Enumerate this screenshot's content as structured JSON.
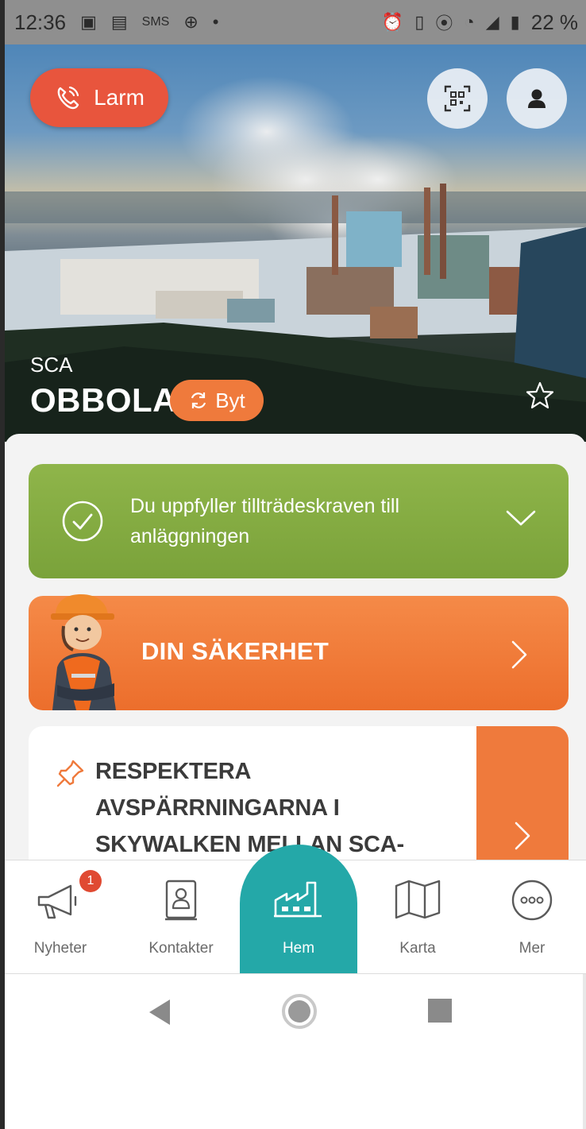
{
  "status_bar": {
    "time": "12:36",
    "battery": "22 %",
    "icons": [
      "image-icon",
      "gallery-icon",
      "sms-icon",
      "app-icon",
      "dot-icon",
      "alarm-icon",
      "vibrate-icon",
      "location-icon",
      "wifi-icon",
      "signal-icon",
      "battery-icon"
    ]
  },
  "hero": {
    "alarm_button": "Larm",
    "site_company": "SCA",
    "site_name": "OBBOLA",
    "switch_button": "Byt"
  },
  "access_card": {
    "text": "Du uppfyller tillträdeskraven till anläggningen"
  },
  "safety_card": {
    "title": "DIN SÄKERHET"
  },
  "news_card": {
    "headline": "RESPEKTERA AVSPÄRRNINGARNA I SKYWALKEN MELLAN SCA-KONTORET OCH"
  },
  "bottom_nav": {
    "items": [
      {
        "label": "Nyheter",
        "badge": "1"
      },
      {
        "label": "Kontakter"
      },
      {
        "label": "Hem"
      },
      {
        "label": "Karta"
      },
      {
        "label": "Mer"
      }
    ]
  },
  "colors": {
    "alarm": "#e8553d",
    "accent_orange": "#ef7a3c",
    "success_green": "#84ab42",
    "home_teal": "#24a8a8"
  }
}
